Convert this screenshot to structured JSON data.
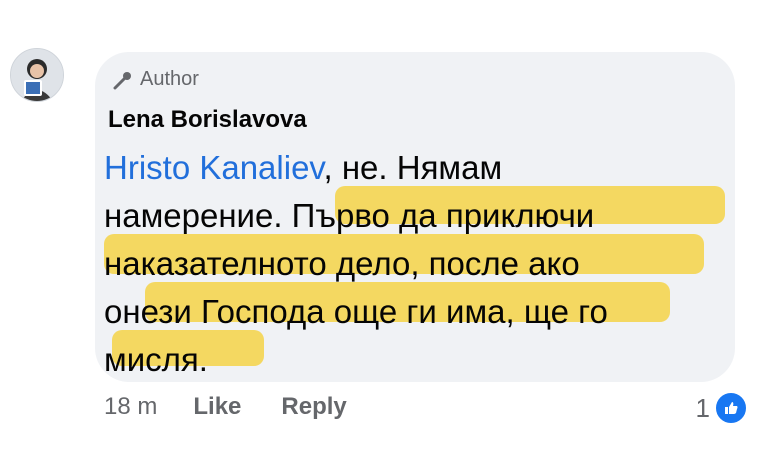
{
  "comment": {
    "author_badge": "Author",
    "name": "Lena Borislavova",
    "mention": "Hristo Kanaliev",
    "lines": [
      ", не. Нямам",
      "намерение. Първо да приключи",
      "наказателното дело, после ако",
      "онези Господа още ги има, ще го",
      "мисля."
    ]
  },
  "footer": {
    "time": "18 m",
    "like_label": "Like",
    "reply_label": "Reply",
    "reaction_count": "1"
  },
  "icons": {
    "badge": "microphone-icon",
    "reaction": "thumbs-up-icon"
  },
  "colors": {
    "bubble": "#f0f2f5",
    "mention": "#216fdb",
    "highlight": "#f5cd28",
    "like_blue": "#1877f2"
  }
}
